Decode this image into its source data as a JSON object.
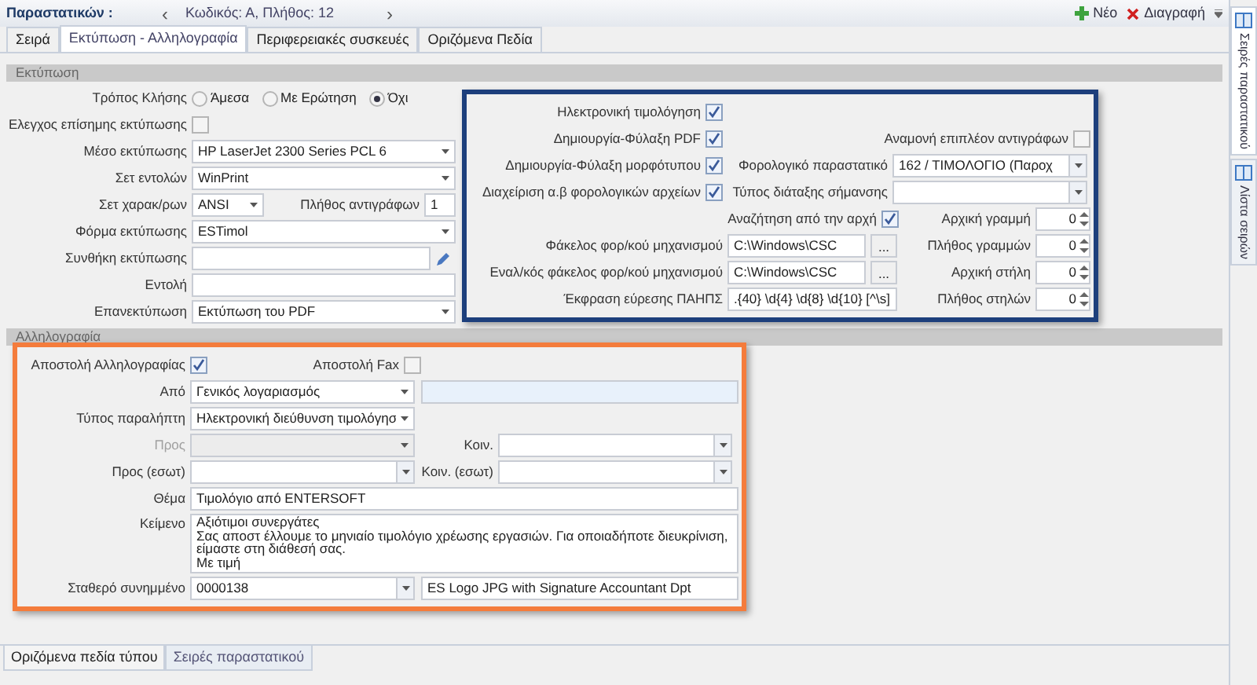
{
  "header": {
    "title": "Παραστατικών :",
    "prev": "‹",
    "summary": "Κωδικός: Α, Πλήθος: 12",
    "next": "›",
    "actions": [
      {
        "kind": "new",
        "label": "Νέο"
      },
      {
        "kind": "delete",
        "label": "Διαγραφή"
      }
    ]
  },
  "tabs": [
    {
      "label": "Σειρά",
      "selected": false
    },
    {
      "label": "Εκτύπωση - Αλληλογραφία",
      "selected": true
    },
    {
      "label": "Περιφερειακές συσκευές",
      "selected": false
    },
    {
      "label": "Οριζόμενα Πεδία",
      "selected": false
    }
  ],
  "print_section": {
    "title": "Εκτύπωση",
    "call_mode": {
      "label": "Τρόπος Κλήσης",
      "options": [
        {
          "label": "Άμεσα",
          "selected": false
        },
        {
          "label": "Με Ερώτηση",
          "selected": false
        },
        {
          "label": "Όχι",
          "selected": true
        }
      ]
    },
    "official_check": {
      "label": "Ελεγχος επίσημης εκτύπωσης",
      "checked": false
    },
    "fields": [
      {
        "kind": "select",
        "label": "Μέσο εκτύπωσης",
        "value": "HP LaserJet 2300 Series PCL 6"
      },
      {
        "kind": "select",
        "label": "Σετ εντολών",
        "value": "WinPrint"
      },
      {
        "kind": "charset",
        "label": "Σετ χαρακ/ρων",
        "value": "ANSI",
        "copies_label": "Πλήθος αντιγράφων",
        "copies": "1"
      },
      {
        "kind": "select",
        "label": "Φόρμα εκτύπωσης",
        "value": "ESTimol"
      },
      {
        "kind": "condition",
        "label": "Συνθήκη εκτύπωσης"
      },
      {
        "kind": "text",
        "label": "Εντολή"
      },
      {
        "kind": "select",
        "label": "Επανεκτύπωση",
        "value": "Εκτύπωση του PDF"
      }
    ],
    "einvoice": {
      "rows": [
        {
          "kind": "check",
          "label": "Ηλεκτρονική τιμολόγηση",
          "checked": true
        },
        {
          "kind": "check",
          "label": "Δημιουργία-Φύλαξη PDF",
          "checked": true,
          "right": {
            "kind": "check",
            "label": "Αναμονή επιπλέον αντιγράφων",
            "checked": false
          }
        },
        {
          "kind": "check",
          "label": "Δημιουργία-Φύλαξη μορφότυπου",
          "checked": true,
          "right": {
            "kind": "select",
            "label": "Φορολογικό παραστατικό",
            "value": "162 / ΤΙΜΟΛΟΓΙΟ (Παροχ"
          }
        },
        {
          "kind": "check",
          "label": "Διαχείριση α.β φορολογικών αρχείων",
          "checked": true,
          "right": {
            "kind": "select",
            "label": "Τύπος διάταξης σήμανσης"
          }
        },
        {
          "kind": "wide_check",
          "label": "Αναζήτηση από την αρχή",
          "checked": true,
          "right": {
            "kind": "spin",
            "label": "Αρχική γραμμή",
            "value": "0"
          }
        },
        {
          "kind": "folder",
          "label": "Φάκελος φορ/κού μηχανισμού",
          "value": "C:\\Windows\\CSC",
          "button": "...",
          "right": {
            "kind": "spin",
            "label": "Πλήθος γραμμών",
            "value": "0"
          }
        },
        {
          "kind": "folder",
          "label": "Εναλ/κός φάκελος φορ/κού μηχανισμού",
          "value": "C:\\Windows\\CSC",
          "button": "...",
          "right": {
            "kind": "spin",
            "label": "Αρχική στήλη",
            "value": "0"
          }
        },
        {
          "kind": "text",
          "label": "Έκφραση εύρεσης ΠΑΗΠΣ",
          "value": ".{40} \\d{4} \\d{8} \\d{10} [^\\s]",
          "right": {
            "kind": "spin",
            "label": "Πλήθος στηλών",
            "value": "0"
          }
        }
      ]
    }
  },
  "mail_section": {
    "title": "Αλληλογραφία",
    "send_mail": {
      "label": "Αποστολή Αλληλογραφίας",
      "checked": true
    },
    "send_fax": {
      "label": "Αποστολή Fax",
      "checked": false
    },
    "from": {
      "label": "Από",
      "value": "Γενικός λογαριασμός"
    },
    "recipient_type": {
      "label": "Τύπος παραλήπτη",
      "value": "Ηλεκτρονική διεύθυνση τιμολόγησ"
    },
    "to": {
      "label": "Προς",
      "disabled": true
    },
    "cc": {
      "label": "Κοιν."
    },
    "to_internal": {
      "label": "Προς (εσωτ)"
    },
    "cc_internal": {
      "label": "Κοιν. (εσωτ)"
    },
    "subject": {
      "label": "Θέμα",
      "value": "Τιμολόγιο από ENTERSOFT"
    },
    "body": {
      "label": "Κείμενο",
      "lines": [
        "Αξιότιμοι συνεργάτες",
        "Σας αποστ έλλουμε το μηνιαίο τιμολόγιο χρέωσης εργασιών. Για οποιαδήποτε διευκρίνιση,",
        "είμαστε στη διάθεσή σας.",
        "Με τιμή"
      ]
    },
    "attachment": {
      "label": "Σταθερό συνημμένο",
      "value": "0000138",
      "description": "ES Logo JPG with Signature Accountant Dpt"
    }
  },
  "bottom_tabs": [
    {
      "label": "Οριζόμενα πεδία τύπου",
      "selected": true
    },
    {
      "label": "Σειρές παραστατικού",
      "selected": false
    }
  ],
  "side_tabs": [
    {
      "label": "Σειρές παραστατικού",
      "selected": true
    },
    {
      "label": "Λίστα σειρών",
      "selected": false
    }
  ]
}
